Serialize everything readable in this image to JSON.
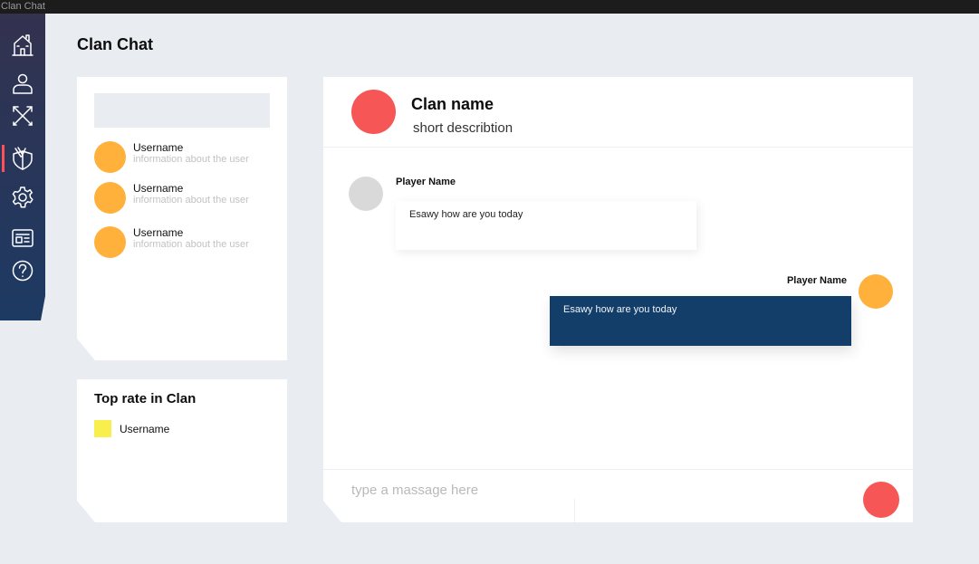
{
  "window": {
    "title": "Clan Chat"
  },
  "sidebar": {
    "items": [
      {
        "icon": "home-icon",
        "active": false
      },
      {
        "icon": "user-icon",
        "active": false
      },
      {
        "icon": "crossed-arrows-icon",
        "active": false
      },
      {
        "icon": "shield-icon",
        "active": true
      },
      {
        "icon": "gear-icon",
        "active": false
      },
      {
        "icon": "news-icon",
        "active": false
      },
      {
        "icon": "help-icon",
        "active": false
      }
    ]
  },
  "page": {
    "title": "Clan Chat"
  },
  "search": {
    "value": "",
    "placeholder": ""
  },
  "users": [
    {
      "name": "Username",
      "info": "information about the user"
    },
    {
      "name": "Username",
      "info": "information about the user"
    },
    {
      "name": "Username",
      "info": "information about the user"
    }
  ],
  "top_rate": {
    "title": "Top rate in Clan",
    "items": [
      {
        "name": "Username"
      }
    ]
  },
  "chat": {
    "clan_name": "Clan name",
    "description": "short describtion",
    "messages": [
      {
        "sender": "Player Name",
        "text": "Esawy how are you today",
        "side": "left"
      },
      {
        "sender": "Player Name",
        "text": "Esawy how are you today",
        "side": "right"
      }
    ],
    "input": {
      "value": "",
      "placeholder": "type a massage here"
    }
  },
  "colors": {
    "accent": "#f75656",
    "avatar_orange": "#ffb13b",
    "bubble_dark": "#143e6a",
    "top_rate_marker": "#f8ef4d",
    "sidebar_top": "#33324f",
    "sidebar_bottom": "#1d3a63",
    "background": "#e9ecf1"
  }
}
